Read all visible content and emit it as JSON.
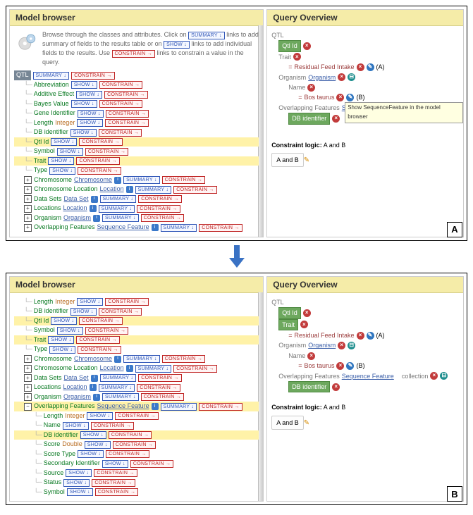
{
  "headers": {
    "model_browser": "Model browser",
    "query_overview": "Query Overview"
  },
  "intro": {
    "t1": "Browse through the classes and attributes. Click on ",
    "t2": " links to add summary of fields to the results table or on ",
    "t3": " links to add individual fields to the results. Use ",
    "t4": " links to constrain a value in the query."
  },
  "pills": {
    "summary": "SUMMARY ↓",
    "show": "SHOW ↓",
    "constrain": "CONSTRAIN →"
  },
  "icons": {
    "plus": "+",
    "minus": "−",
    "info": "i",
    "close": "×",
    "pencil": "✎"
  },
  "root": "QTL",
  "types": {
    "integer": "Integer",
    "double": "Double",
    "chromosome": "Chromosome",
    "location": "Location",
    "dataset": "Data Set",
    "organism": "Organism",
    "seqfeat": "Sequence Feature"
  },
  "attrs": {
    "abbreviation": "Abbreviation",
    "additive_effect": "Additive Effect",
    "bayes_value": "Bayes Value",
    "gene_identifier": "Gene Identifier",
    "length": "Length",
    "db_identifier": "DB identifier",
    "qtl_id": "Qtl Id",
    "symbol": "Symbol",
    "trait": "Trait",
    "type": "Type",
    "name": "Name",
    "score": "Score",
    "score_type": "Score Type",
    "secondary_identifier": "Secondary Identifier",
    "source": "Source",
    "status": "Status"
  },
  "refs": {
    "chromosome": "Chromosome",
    "chromosome_location": "Chromosome Location",
    "data_sets": "Data Sets",
    "locations": "Locations",
    "organism": "Organism",
    "overlapping_features": "Overlapping Features"
  },
  "query": {
    "root": "QTL",
    "qtl_id": "Qtl Id",
    "trait": "Trait",
    "residual": "Residual Feed Intake",
    "organism": "Organism",
    "name": "Name",
    "bos": "Bos taurus",
    "overlap": "Overlapping Features",
    "seqfeat_link": "Sequence Feature",
    "collection": "collection",
    "db_id": "DB identifier",
    "eq": "=",
    "a": "(A)",
    "b": "(B)"
  },
  "tooltip": "Show SequenceFeature in the model browser",
  "constraint": {
    "label": "Constraint logic:",
    "text": "A and B",
    "box": "A and B"
  },
  "letters": {
    "a": "A",
    "b": "B"
  }
}
